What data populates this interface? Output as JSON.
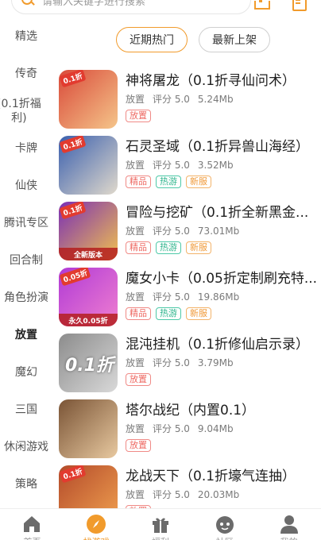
{
  "search": {
    "placeholder": "请输入关键字进行搜索"
  },
  "sidebar": {
    "items": [
      {
        "label": "精选",
        "active": false
      },
      {
        "label": "传奇",
        "active": false
      },
      {
        "label": "(0.1折福\n利)",
        "active": false
      },
      {
        "label": "卡牌",
        "active": false
      },
      {
        "label": "仙侠",
        "active": false
      },
      {
        "label": "腾讯专区",
        "active": false
      },
      {
        "label": "回合制",
        "active": false
      },
      {
        "label": "角色扮演",
        "active": false
      },
      {
        "label": "放置",
        "active": true
      },
      {
        "label": "魔幻",
        "active": false
      },
      {
        "label": "三国",
        "active": false
      },
      {
        "label": "休闲游戏",
        "active": false
      },
      {
        "label": "策略",
        "active": false
      }
    ]
  },
  "tabs": {
    "hot": "近期热门",
    "new": "最新上架"
  },
  "games": [
    {
      "title": "神将屠龙（0.1折寻仙问术）",
      "genre": "放置",
      "rating": "评分 5.0",
      "size": "5.24Mb",
      "tags": [
        {
          "text": "放置",
          "kind": "genre"
        }
      ],
      "badge": "0.1折",
      "strip": "",
      "colors": [
        "#d94a3a",
        "#f5c58a"
      ]
    },
    {
      "title": "石灵圣域（0.1折异兽山海经）",
      "genre": "放置",
      "rating": "评分 5.0",
      "size": "3.52Mb",
      "tags": [
        {
          "text": "精品",
          "kind": "genre"
        },
        {
          "text": "热游",
          "kind": "hot"
        },
        {
          "text": "新服",
          "kind": "new"
        }
      ],
      "badge": "0.1折",
      "strip": "",
      "colors": [
        "#3a5fae",
        "#e0d9cc"
      ]
    },
    {
      "title": "冒险与挖矿（0.1折全新黑金...",
      "genre": "放置",
      "rating": "评分 5.0",
      "size": "73.01Mb",
      "tags": [
        {
          "text": "精品",
          "kind": "genre"
        },
        {
          "text": "热游",
          "kind": "hot"
        },
        {
          "text": "新服",
          "kind": "new"
        }
      ],
      "badge": "0.1折",
      "strip": "全新版本",
      "colors": [
        "#7a2fb5",
        "#f2c14e"
      ]
    },
    {
      "title": "魔女小卡（0.05折定制刷充特...",
      "genre": "放置",
      "rating": "评分 5.0",
      "size": "19.86Mb",
      "tags": [
        {
          "text": "精品",
          "kind": "genre"
        },
        {
          "text": "热游",
          "kind": "hot"
        },
        {
          "text": "新服",
          "kind": "new"
        }
      ],
      "badge": "0.05折",
      "strip": "永久0.05折",
      "colors": [
        "#b03ad6",
        "#f07fd0"
      ]
    },
    {
      "title": "混沌挂机（0.1折修仙启示录）",
      "genre": "放置",
      "rating": "评分 5.0",
      "size": "3.79Mb",
      "tags": [
        {
          "text": "放置",
          "kind": "genre"
        }
      ],
      "badge": "",
      "strip": "",
      "colors": [
        "#8c8c8c",
        "#d9d9d9"
      ],
      "big_text": "0.1折"
    },
    {
      "title": "塔尔战纪（内置0.1）",
      "genre": "放置",
      "rating": "评分 5.0",
      "size": "9.04Mb",
      "tags": [
        {
          "text": "放置",
          "kind": "genre"
        }
      ],
      "badge": "",
      "strip": "",
      "colors": [
        "#7a5436",
        "#e8c9a0"
      ]
    },
    {
      "title": "龙战天下（0.1折壕气连抽）",
      "genre": "放置",
      "rating": "评分 5.0",
      "size": "20.03Mb",
      "tags": [
        {
          "text": "放置",
          "kind": "genre"
        }
      ],
      "badge": "0.1折",
      "strip": "",
      "colors": [
        "#b34a2a",
        "#f0a050"
      ]
    }
  ],
  "bottom_nav": [
    {
      "label": "首页",
      "icon": "home-icon",
      "active": false
    },
    {
      "label": "找游戏",
      "icon": "compass-icon",
      "active": true
    },
    {
      "label": "福利",
      "icon": "gift-icon",
      "active": false
    },
    {
      "label": "社区",
      "icon": "community-icon",
      "active": false
    },
    {
      "label": "我的",
      "icon": "user-icon",
      "active": false
    }
  ],
  "accent_color": "#f19b2c"
}
